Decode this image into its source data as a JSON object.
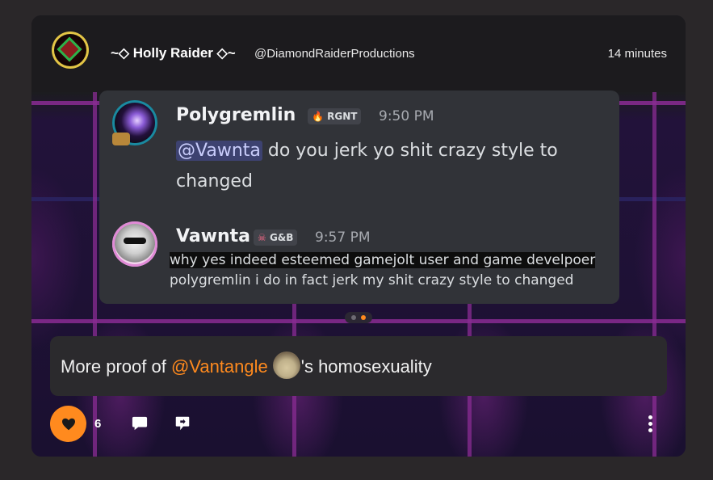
{
  "post": {
    "author": "~◇ Holly Raider ◇~",
    "handle": "@DiamondRaiderProductions",
    "time": "14 minutes",
    "caption_before": "More proof of ",
    "caption_mention": "@Vantangle",
    "caption_after": "'s homosexuality",
    "likes": "6"
  },
  "embed": {
    "messages": [
      {
        "name": "Polygremlin",
        "tag": "RGNT",
        "time": "9:50 PM",
        "mention": "@Vawnta",
        "text_line1": " do you jerk yo shit crazy style to",
        "text_line2": "changed"
      },
      {
        "name": "Vawnta",
        "tag": "G&B",
        "time": "9:57 PM",
        "text_line1": "why yes indeed esteemed gamejolt user and game develpoer",
        "text_line2": "polygremlin i do in fact jerk my shit crazy style to changed"
      }
    ]
  },
  "icons": {
    "like": "heart-icon",
    "comment": "comment-icon",
    "share": "share-icon",
    "more": "more-vertical-icon"
  },
  "colors": {
    "accent": "#ff8a1e",
    "embed_bg": "#313338",
    "grid": "#8a2c93"
  }
}
